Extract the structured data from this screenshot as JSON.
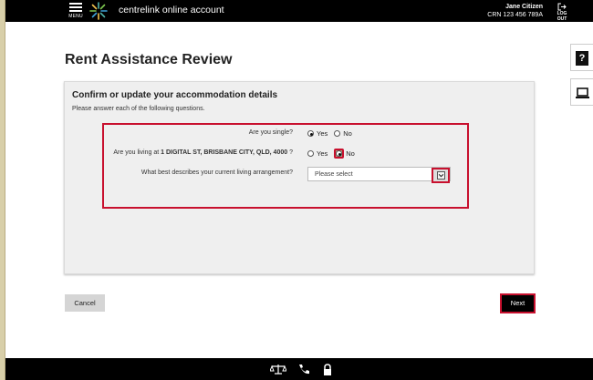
{
  "header": {
    "menu_label": "MENU",
    "brand": "centrelink online account",
    "user_name": "Jane Citizen",
    "crn": "CRN  123 456 789A",
    "logout_label": "LOG OUT"
  },
  "side_tools": {
    "help_icon": "question-icon",
    "help_glyph": "?",
    "device_icon": "laptop-icon"
  },
  "page": {
    "title": "Rent Assistance Review"
  },
  "panel": {
    "heading": "Confirm or update your accommodation details",
    "subheading": "Please answer each of the following questions.",
    "questions": {
      "single": {
        "label": "Are you single?",
        "options": [
          "Yes",
          "No"
        ],
        "selected": "Yes"
      },
      "living": {
        "label_prefix": "Are you living at",
        "address": "1 DIGITAL ST, BRISBANE CITY, QLD, 4000",
        "label_suffix": "?",
        "options": [
          "Yes",
          "No"
        ],
        "selected": "No"
      },
      "arrangement": {
        "label": "What best describes your current living arrangement?",
        "selected_value": "Please select"
      }
    }
  },
  "actions": {
    "cancel_label": "Cancel",
    "next_label": "Next"
  },
  "footer": {
    "icons": [
      "scales-icon",
      "phone-icon",
      "lock-icon"
    ]
  },
  "colors": {
    "header_bg": "#000000",
    "highlight_red": "#c8102e",
    "panel_bg": "#efefef"
  }
}
